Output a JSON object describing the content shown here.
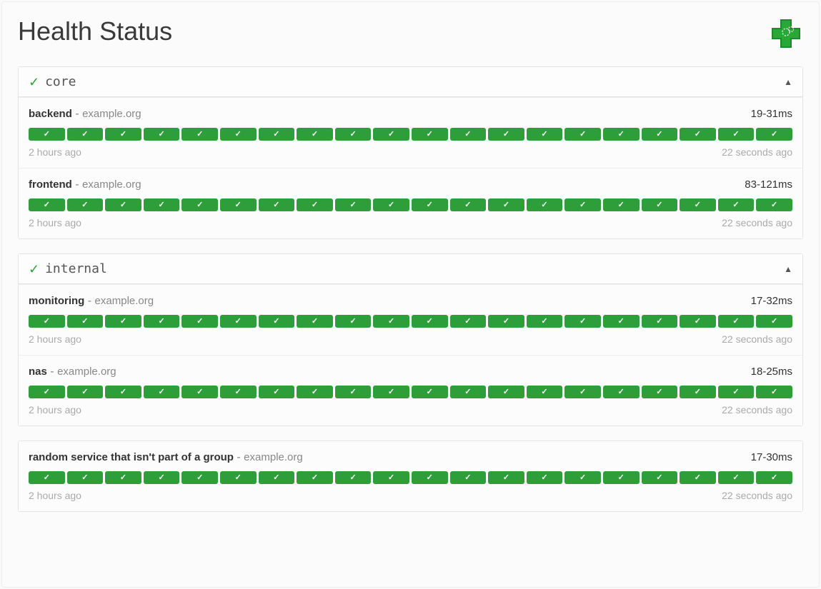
{
  "title": "Health Status",
  "bars_per_service": 20,
  "groups": [
    {
      "name": "core",
      "services": [
        {
          "name": "backend",
          "host": "example.org",
          "ping": "19-31ms",
          "oldest": "2 hours ago",
          "newest": "22 seconds ago"
        },
        {
          "name": "frontend",
          "host": "example.org",
          "ping": "83-121ms",
          "oldest": "2 hours ago",
          "newest": "22 seconds ago"
        }
      ]
    },
    {
      "name": "internal",
      "services": [
        {
          "name": "monitoring",
          "host": "example.org",
          "ping": "17-32ms",
          "oldest": "2 hours ago",
          "newest": "22 seconds ago"
        },
        {
          "name": "nas",
          "host": "example.org",
          "ping": "18-25ms",
          "oldest": "2 hours ago",
          "newest": "22 seconds ago"
        }
      ]
    }
  ],
  "standalone": {
    "name": "random service that isn't part of a group",
    "host": "example.org",
    "ping": "17-30ms",
    "oldest": "2 hours ago",
    "newest": "22 seconds ago"
  },
  "separator": " - "
}
